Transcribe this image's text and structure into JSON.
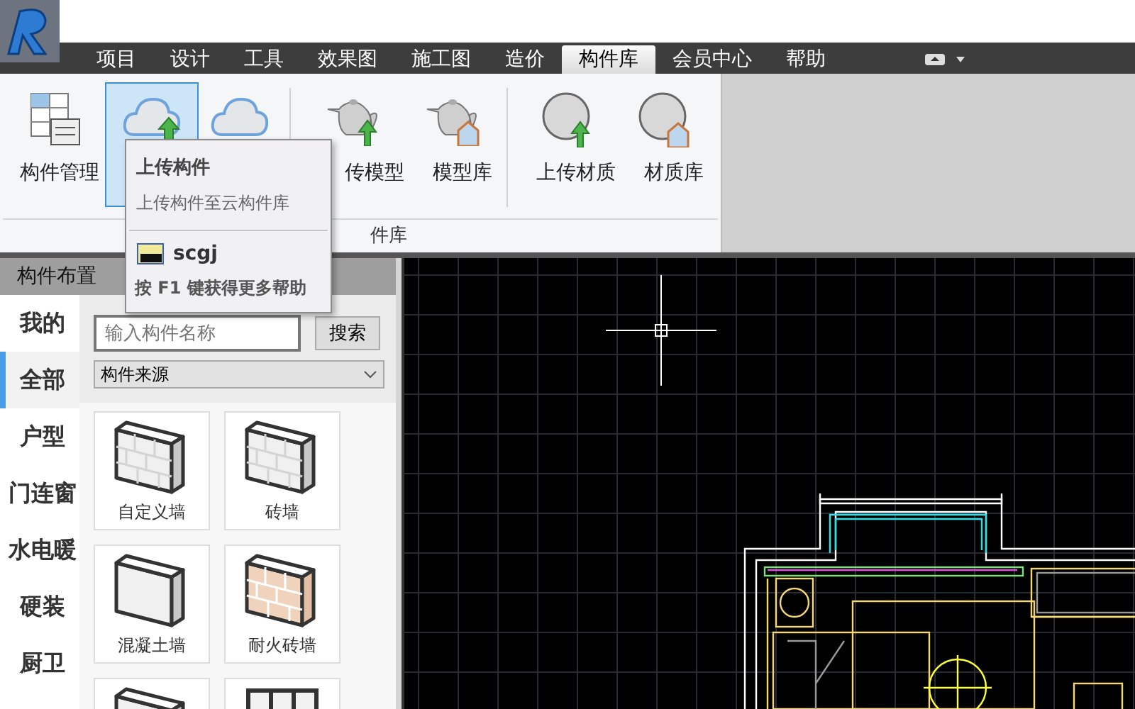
{
  "menu": [
    {
      "label": "项目",
      "selected": false
    },
    {
      "label": "设计",
      "selected": false
    },
    {
      "label": "工具",
      "selected": false
    },
    {
      "label": "效果图",
      "selected": false
    },
    {
      "label": "施工图",
      "selected": false
    },
    {
      "label": "造价",
      "selected": false
    },
    {
      "label": "构件库",
      "selected": true
    },
    {
      "label": "会员中心",
      "selected": false
    },
    {
      "label": "帮助",
      "selected": false
    }
  ],
  "ribbon": {
    "items": [
      {
        "kind": "grid",
        "label": "构件管理",
        "selected": false
      },
      {
        "kind": "cloud-up",
        "selected": true
      },
      {
        "kind": "cloud",
        "selected": false
      },
      {
        "kind": "teapot-up",
        "label": "传模型",
        "selected": false
      },
      {
        "kind": "teapot-lib",
        "label": "模型库",
        "selected": false
      },
      {
        "kind": "sphere-up",
        "label": "上传材质",
        "selected": false
      },
      {
        "kind": "sphere-lib",
        "label": "材质库",
        "selected": false
      }
    ],
    "group_label": "件库"
  },
  "tooltip": {
    "title": "上传构件",
    "description": "上传构件至云构件库",
    "command": "scgj",
    "help": "按 F1 键获得更多帮助"
  },
  "panel": {
    "title": "构件布置",
    "tabs": [
      {
        "label": "我的",
        "selected": false
      },
      {
        "label": "全部",
        "selected": true
      },
      {
        "label": "户型",
        "selected": false
      },
      {
        "label": "门连窗",
        "selected": false
      },
      {
        "label": "水电暖",
        "selected": false
      },
      {
        "label": "硬装",
        "selected": false
      },
      {
        "label": "厨卫",
        "selected": false
      }
    ],
    "search": {
      "placeholder": "输入构件名称",
      "button": "搜索"
    },
    "source": "构件来源",
    "cards": [
      {
        "kind": "brick",
        "label": "自定义墙"
      },
      {
        "kind": "brick",
        "label": "砖墙"
      },
      {
        "kind": "plain",
        "label": "混凝土墙"
      },
      {
        "kind": "fire",
        "label": "耐火砖墙"
      },
      {
        "kind": "plain"
      },
      {
        "kind": "frame"
      }
    ]
  }
}
